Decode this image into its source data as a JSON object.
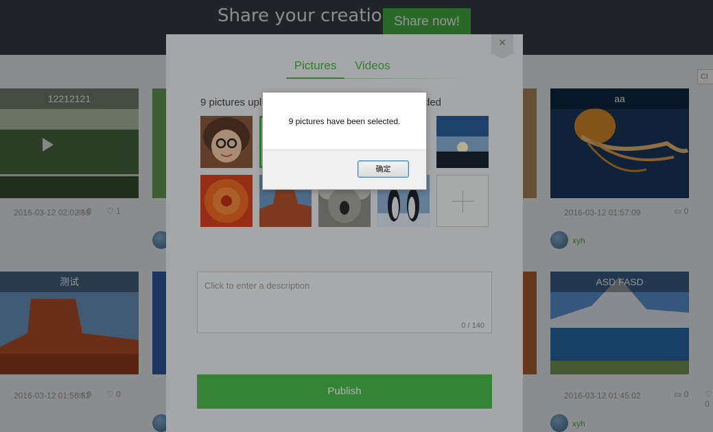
{
  "header": {
    "slogan": "Share your creations",
    "share_button": "Share now!"
  },
  "background_cards": [
    {
      "title": "12212121",
      "date": "2016-03-12 02:02:58",
      "comments": "0",
      "likes": "1",
      "user": ""
    },
    {
      "title": "aa",
      "date": "2016-03-12 01:57:09",
      "comments": "0",
      "likes": "0",
      "user": "xyh"
    },
    {
      "title": "测试",
      "date": "2016-03-12 01:56:52",
      "comments": "0",
      "likes": "0",
      "user": ""
    },
    {
      "title": "ASD FASD",
      "date": "2016-03-12 01:45:02",
      "comments": "0",
      "likes": "0",
      "user": "xyh"
    }
  ],
  "corner_button": "Cl",
  "upload_modal": {
    "close_glyph": "×",
    "tabs": [
      {
        "label": "Pictures",
        "active": true
      },
      {
        "label": "Videos",
        "active": false
      }
    ],
    "status_text": "9 pictures upl",
    "status_tail": "ded",
    "thumbnails": [
      "portrait",
      "green-frame",
      "covered",
      "covered",
      "sunset",
      "flower",
      "canyon",
      "koala",
      "penguins"
    ],
    "description_placeholder": "Click to enter a description",
    "char_count": "0 / 140",
    "publish_button": "Publish"
  },
  "alert": {
    "message": "9 pictures have been selected.",
    "ok_button": "确定"
  },
  "colors": {
    "accent": "#47b347",
    "publish": "#4cbd4c",
    "topbar": "#3a3f45"
  }
}
